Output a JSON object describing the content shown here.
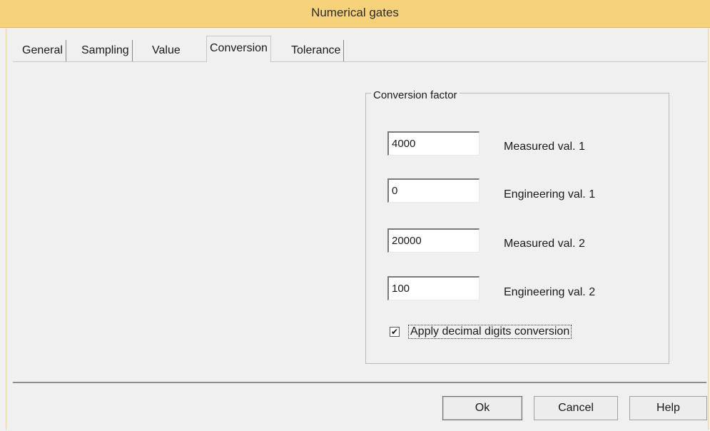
{
  "window": {
    "title": "Numerical gates"
  },
  "tabs": [
    {
      "label": "General"
    },
    {
      "label": "Sampling"
    },
    {
      "label": "Value"
    },
    {
      "label": "Conversion",
      "active": true
    },
    {
      "label": "Tolerance"
    }
  ],
  "conversion": {
    "group_title": "Conversion factor",
    "fields": [
      {
        "value": "4000",
        "label": "Measured val. 1"
      },
      {
        "value": "0",
        "label": "Engineering val. 1"
      },
      {
        "value": "20000",
        "label": "Measured val. 2"
      },
      {
        "value": "100",
        "label": "Engineering val. 2"
      }
    ],
    "checkbox": {
      "label": "Apply decimal digits conversion",
      "checked": true,
      "mark": "✔"
    }
  },
  "buttons": {
    "ok": "Ok",
    "cancel": "Cancel",
    "help": "Help"
  },
  "colors": {
    "titlebar": "#f6d27a"
  }
}
